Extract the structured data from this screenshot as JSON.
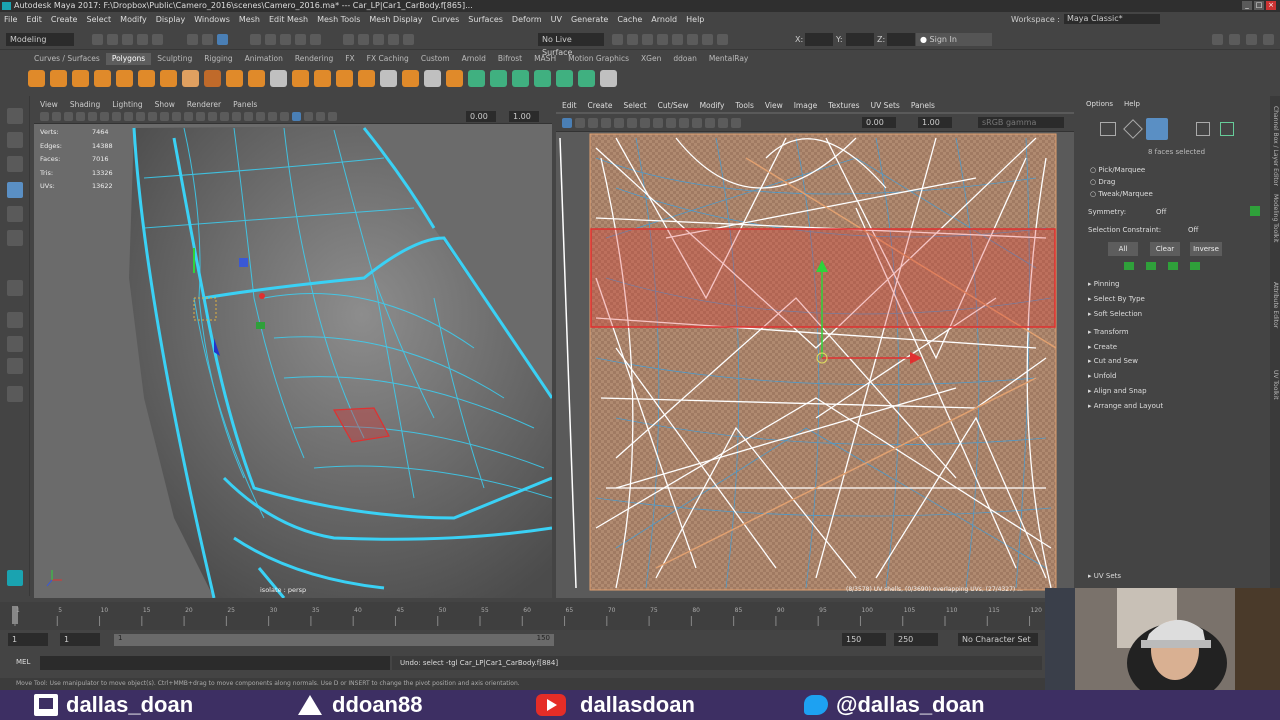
{
  "window": {
    "title": "Autodesk Maya 2017: F:\\Dropbox\\Public\\Camero_2016\\scenes\\Camero_2016.ma*   ---   Car_LP|Car1_CarBody.f[865]...",
    "controls": [
      "_",
      "□",
      "×"
    ]
  },
  "menubar": [
    "File",
    "Edit",
    "Create",
    "Select",
    "Modify",
    "Display",
    "Windows",
    "Mesh",
    "Edit Mesh",
    "Mesh Tools",
    "Mesh Display",
    "Curves",
    "Surfaces",
    "Deform",
    "UV",
    "Generate",
    "Cache",
    "Arnold",
    "Help"
  ],
  "workspace": {
    "label": "Workspace :",
    "value": "Maya Classic*"
  },
  "statusline": {
    "mode": "Modeling",
    "live_surface": "No Live Surface",
    "x_label": "X:",
    "y_label": "Y:",
    "z_label": "Z:",
    "sign_in": "Sign In"
  },
  "shelf_tabs": [
    "Curves / Surfaces",
    "Polygons",
    "Sculpting",
    "Rigging",
    "Animation",
    "Rendering",
    "FX",
    "FX Caching",
    "Custom",
    "Arnold",
    "Bifrost",
    "MASH",
    "Motion Graphics",
    "XGen",
    "ddoan",
    "MentalRay"
  ],
  "shelf_active": "Polygons",
  "viewport": {
    "menu": [
      "View",
      "Shading",
      "Lighting",
      "Show",
      "Renderer",
      "Panels"
    ],
    "field_a": "0.00",
    "field_b": "1.00",
    "hud": [
      {
        "label": "Verts:",
        "value": "7464"
      },
      {
        "label": "Edges:",
        "value": "14388"
      },
      {
        "label": "Faces:",
        "value": "7016"
      },
      {
        "label": "Tris:",
        "value": "13326"
      },
      {
        "label": "UVs:",
        "value": "13622"
      }
    ],
    "bottom_label": "isolate : persp"
  },
  "uv_editor": {
    "menu": [
      "Edit",
      "Create",
      "Select",
      "Cut/Sew",
      "Modify",
      "Tools",
      "View",
      "Image",
      "Textures",
      "UV Sets",
      "Panels"
    ],
    "field_a": "0.00",
    "field_b": "1.00",
    "field_c": "sRGB gamma",
    "status": "(8/3578) UV shells, (0/3690) overlapping UVs, (27/4327) ..."
  },
  "uv_toolkit": {
    "menu": [
      "Options",
      "Help"
    ],
    "selected_text": "8 faces selected",
    "modes": [
      "Pick/Marquee",
      "Drag",
      "Tweak/Marquee"
    ],
    "symmetry_label": "Symmetry:",
    "symmetry_value": "Off",
    "constraint_label": "Selection Constraint:",
    "constraint_value": "Off",
    "buttons": [
      "All",
      "Clear",
      "Inverse"
    ],
    "sections_top": [
      "Pinning",
      "Select By Type",
      "Soft Selection"
    ],
    "sections": [
      "Transform",
      "Create",
      "Cut and Sew",
      "Unfold",
      "Align and Snap",
      "Arrange and Layout"
    ],
    "footer": "UV Sets",
    "side_tabs": [
      "Channel Box / Layer Editor",
      "Modeling Toolkit",
      "Attribute Editor",
      "UV Toolkit"
    ]
  },
  "timeline": {
    "ticks": [
      "1",
      "5",
      "10",
      "15",
      "20",
      "25",
      "30",
      "35",
      "40",
      "45",
      "50",
      "55",
      "60",
      "65",
      "70",
      "75",
      "80",
      "85",
      "90",
      "95",
      "100",
      "105",
      "110",
      "115",
      "120"
    ],
    "current": "1",
    "range_start": "1",
    "range_inner_start": "1",
    "range_marker": "1",
    "range_inner_end": "150",
    "range_end": "150",
    "anim_end": "250",
    "char_set": "No Character Set"
  },
  "command": {
    "lang": "MEL",
    "result": "Undo: select -tgl Car_LP|Car1_CarBody.f[884]"
  },
  "help_line": "Move Tool: Use manipulator to move object(s). Ctrl+MMB+drag to move components along normals. Use D or INSERT to change the pivot position and axis orientation.",
  "socials": [
    {
      "icon": "twitch-icon",
      "handle": "dallas_doan"
    },
    {
      "icon": "artstation-icon",
      "handle": "ddoan88"
    },
    {
      "icon": "youtube-icon",
      "handle": "dallasdoan"
    },
    {
      "icon": "twitter-icon",
      "handle": "@dallas_doan"
    }
  ],
  "colors": {
    "wire": "#3ad1f5",
    "selection": "#e03030",
    "uv_white": "#ffffff",
    "uv_blue": "#3aa0e0",
    "uv_orange": "#e0a070",
    "banner": "#3d2f63"
  }
}
